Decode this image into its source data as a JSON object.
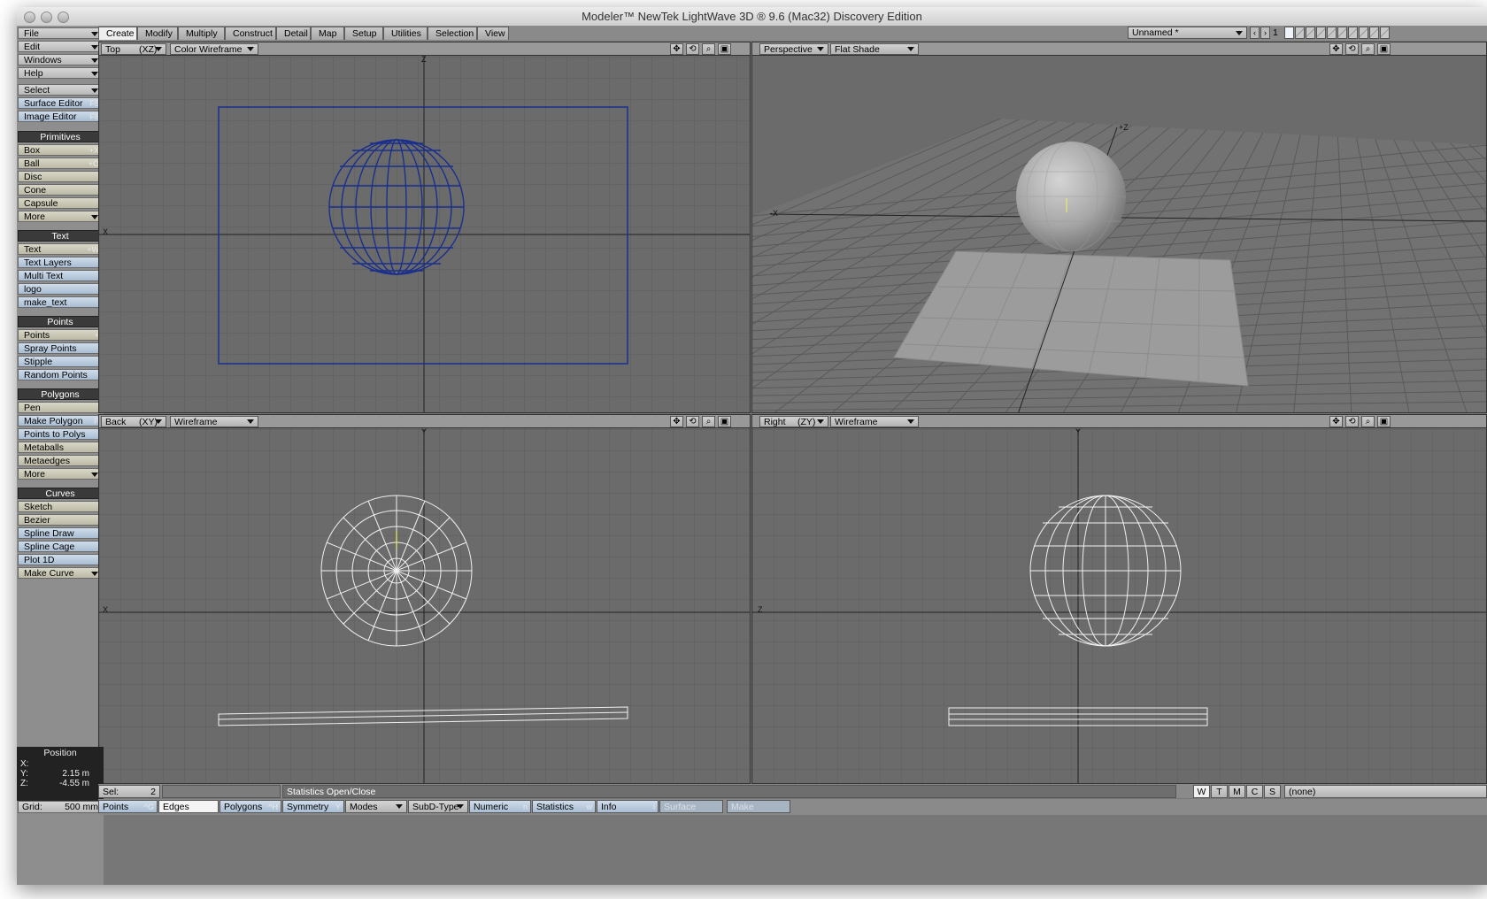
{
  "window": {
    "title": "Modeler™ NewTek LightWave 3D ® 9.6  (Mac32) Discovery Edition"
  },
  "menus": [
    {
      "label": "File",
      "dropdown": true
    },
    {
      "label": "Edit",
      "dropdown": true
    },
    {
      "label": "Windows",
      "dropdown": true
    },
    {
      "label": "Help",
      "dropdown": true
    }
  ],
  "select_menu": {
    "label": "Select"
  },
  "editors": [
    {
      "label": "Surface Editor",
      "shortcut": "F5"
    },
    {
      "label": "Image Editor",
      "shortcut": "F6"
    }
  ],
  "groups": {
    "primitives": {
      "title": "Primitives",
      "items": [
        {
          "label": "Box",
          "shortcut": "+X"
        },
        {
          "label": "Ball",
          "shortcut": "+O"
        },
        {
          "label": "Disc",
          "shortcut": ""
        },
        {
          "label": "Cone",
          "shortcut": ""
        },
        {
          "label": "Capsule",
          "shortcut": ""
        },
        {
          "label": "More",
          "shortcut": ""
        }
      ]
    },
    "text": {
      "title": "Text",
      "items": [
        {
          "label": "Text",
          "shortcut": "+W"
        },
        {
          "label": "Text Layers",
          "shortcut": ""
        },
        {
          "label": "Multi Text",
          "shortcut": ""
        },
        {
          "label": "logo",
          "shortcut": ""
        },
        {
          "label": "make_text",
          "shortcut": ""
        }
      ]
    },
    "points": {
      "title": "Points",
      "items": [
        {
          "label": "Points",
          "shortcut": "+"
        },
        {
          "label": "Spray Points",
          "shortcut": ""
        },
        {
          "label": "Stipple",
          "shortcut": ""
        },
        {
          "label": "Random Points",
          "shortcut": ""
        }
      ]
    },
    "polygons": {
      "title": "Polygons",
      "items": [
        {
          "label": "Pen",
          "shortcut": ""
        },
        {
          "label": "Make Polygon",
          "shortcut": "P"
        },
        {
          "label": "Points to Polys",
          "shortcut": ""
        },
        {
          "label": "Metaballs",
          "shortcut": ""
        },
        {
          "label": "Metaedges",
          "shortcut": ""
        },
        {
          "label": "More",
          "shortcut": ""
        }
      ]
    },
    "curves": {
      "title": "Curves",
      "items": [
        {
          "label": "Sketch",
          "shortcut": ""
        },
        {
          "label": "Bezier",
          "shortcut": ""
        },
        {
          "label": "Spline Draw",
          "shortcut": ""
        },
        {
          "label": "Spline Cage",
          "shortcut": ""
        },
        {
          "label": "Plot 1D",
          "shortcut": ""
        },
        {
          "label": "Make Curve",
          "shortcut": ""
        }
      ]
    }
  },
  "position": {
    "title": "Position",
    "x_label": "X:",
    "y_label": "Y:",
    "z_label": "Z:",
    "x": "",
    "y": "2.15 m",
    "z": "-4.55 m"
  },
  "grid": {
    "label": "Grid:",
    "value": "500 mm"
  },
  "tabs": [
    "Create",
    "Modify",
    "Multiply",
    "Construct",
    "Detail",
    "Map",
    "Setup",
    "Utilities",
    "Selection",
    "View"
  ],
  "object": {
    "name": "Unnamed *",
    "layer": "1"
  },
  "viewports": {
    "top": {
      "view": "Top",
      "axes": "(XZ)",
      "mode": "Color Wireframe",
      "h": "X",
      "v": "Z"
    },
    "persp": {
      "view": "Perspective",
      "mode": "Flat Shade"
    },
    "back": {
      "view": "Back",
      "axes": "(XY)",
      "mode": "Wireframe",
      "h": "X",
      "v": "Y"
    },
    "right": {
      "view": "Right",
      "axes": "(ZY)",
      "mode": "Wireframe",
      "h": "Z",
      "v": "Y"
    }
  },
  "status": {
    "sel_label": "Sel:",
    "sel_value": "2",
    "message": "Statistics Open/Close",
    "surface": "(none)"
  },
  "bottom": {
    "points": "Points",
    "points_sc": "^G",
    "edges": "Edges",
    "polygons": "Polygons",
    "polygons_sc": "^H",
    "symmetry": "Symmetry",
    "symmetry_sc": "Y",
    "modes": "Modes",
    "subd": "SubD-Type",
    "numeric": "Numeric",
    "numeric_sc": "n",
    "statistics": "Statistics",
    "statistics_sc": "w",
    "info": "Info",
    "info_sc": "i",
    "surface": "Surface",
    "make": "Make"
  },
  "view_toggles": [
    "W",
    "T",
    "M",
    "C",
    "S"
  ],
  "colors": {
    "viewport_bg": "#6b6b6b",
    "grid_line": "#5c5c5c",
    "selection_wire": "#1a2f8c",
    "wire": "#f0f0f0"
  }
}
